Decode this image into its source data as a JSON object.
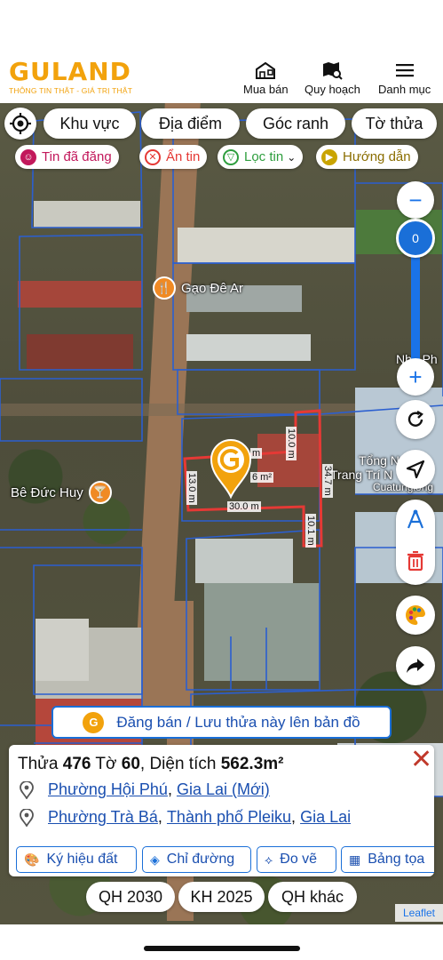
{
  "header": {
    "logo_text": "GULAND",
    "logo_tagline": "THÔNG TIN THẬT - GIÁ TRỊ THẬT",
    "nav": [
      {
        "label": "Mua bán",
        "icon": "house-store-icon"
      },
      {
        "label": "Quy hoạch",
        "icon": "map-search-icon"
      },
      {
        "label": "Danh mục",
        "icon": "hamburger-menu-icon"
      }
    ]
  },
  "filters": {
    "pills": [
      "Khu vực",
      "Địa điểm",
      "Góc ranh",
      "Tờ thửa"
    ],
    "chips": [
      {
        "label": "Tin đã đăng",
        "icon": "posted-icon",
        "color": "#c2185b"
      },
      {
        "label": "Ẩn tin",
        "icon": "hide-icon",
        "color": "#e53935"
      },
      {
        "label": "Lọc tin",
        "icon": "filter-icon",
        "color": "#2e9e3e"
      },
      {
        "label": "Hướng dẫn",
        "icon": "play-guide-icon",
        "color": "#9a7d00"
      }
    ]
  },
  "map": {
    "zoom_value": "0",
    "pois": [
      {
        "label": "Gạo Đê Ar",
        "icon": "restaurant-icon"
      },
      {
        "label": "Bê Đức Huy",
        "icon": "bar-icon"
      }
    ],
    "labels": [
      "Nhà Ph",
      "Tổng N",
      "Trang Trí N",
      "Cuatunglong"
    ],
    "dimensions": [
      "10.0 m",
      "34.7 m",
      "13.0 m",
      "30.0 m",
      "10.1 m",
      "m",
      "6 m²"
    ],
    "accent": "#1a73e8",
    "parcel_color": "#e53935"
  },
  "post_button": {
    "label": "Đăng bán / Lưu thửa này lên bản đồ"
  },
  "parcel": {
    "thua_label": "Thửa",
    "thua": "476",
    "to_label": "Tờ",
    "to": "60",
    "dien_tich_label": ", Diện tích",
    "dien_tich": "562.3m²",
    "address_new": {
      "ward": "Phường Hội Phú",
      "province": "Gia Lai (Mới)"
    },
    "address_old": {
      "ward": "Phường Trà Bá",
      "city": "Thành phố Pleiku",
      "province": "Gia Lai"
    }
  },
  "actions": [
    {
      "label": "Ký hiệu đất",
      "icon": "palette-icon"
    },
    {
      "label": "Chỉ đường",
      "icon": "directions-icon"
    },
    {
      "label": "Đo vẽ",
      "icon": "measure-icon"
    },
    {
      "label": "Bảng tọa",
      "icon": "table-icon"
    }
  ],
  "plans": [
    "QH 2030",
    "KH 2025",
    "QH khác"
  ],
  "attribution": "Leaflet"
}
